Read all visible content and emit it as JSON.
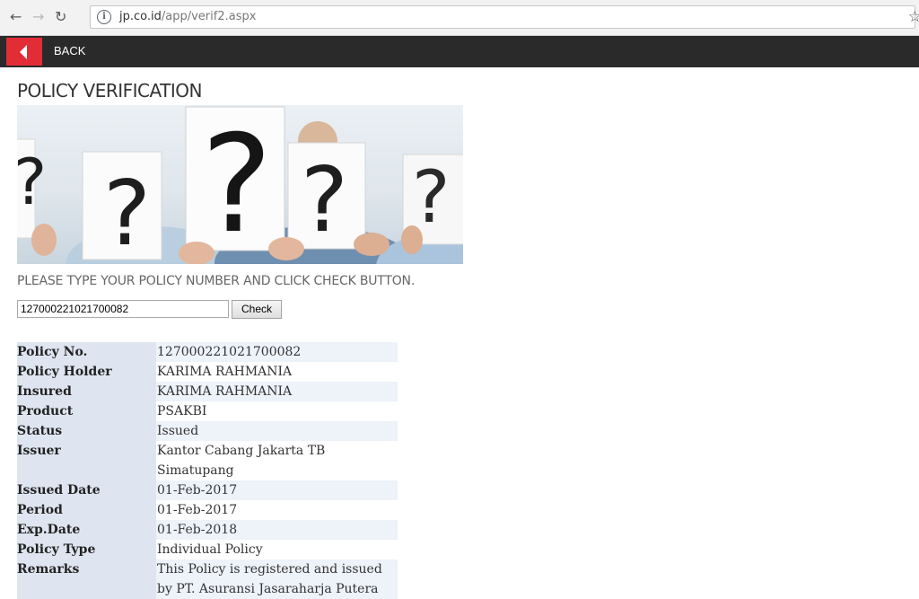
{
  "browser": {
    "url_host": "jp.co.id",
    "url_path": "/app/verif2.aspx",
    "icons": [
      "back-arrow-icon",
      "forward-arrow-icon",
      "reload-icon",
      "info-icon",
      "star-icon"
    ]
  },
  "header": {
    "back_label": "BACK",
    "accent_color": "#e32d36",
    "bar_color": "#2a2a2a"
  },
  "page": {
    "title": "POLICY VERIFICATION",
    "instructions": "PLEASE TYPE YOUR POLICY NUMBER AND CLICK CHECK BUTTON."
  },
  "banner": {
    "marks": [
      "?",
      "?",
      "?",
      "?",
      "?"
    ]
  },
  "form": {
    "policy_number_value": "127000221021700082",
    "check_label": "Check"
  },
  "details": [
    {
      "label": "Policy No.",
      "value": "127000221021700082"
    },
    {
      "label": "Policy Holder",
      "value": "KARIMA RAHMANIA"
    },
    {
      "label": "Insured",
      "value": "KARIMA RAHMANIA"
    },
    {
      "label": "Product",
      "value": "PSAKBI"
    },
    {
      "label": "Status",
      "value": "Issued"
    },
    {
      "label": "Issuer",
      "value": "Kantor Cabang Jakarta TB Simatupang"
    },
    {
      "label": "Issued Date",
      "value": "01-Feb-2017"
    },
    {
      "label": "Period",
      "value": "01-Feb-2017"
    },
    {
      "label": "Exp.Date",
      "value": "01-Feb-2018"
    },
    {
      "label": "Policy Type",
      "value": "Individual Policy"
    },
    {
      "label": "Remarks",
      "value": "This Policy is registered and issued by PT. Asuransi Jasaraharja Putera"
    }
  ]
}
